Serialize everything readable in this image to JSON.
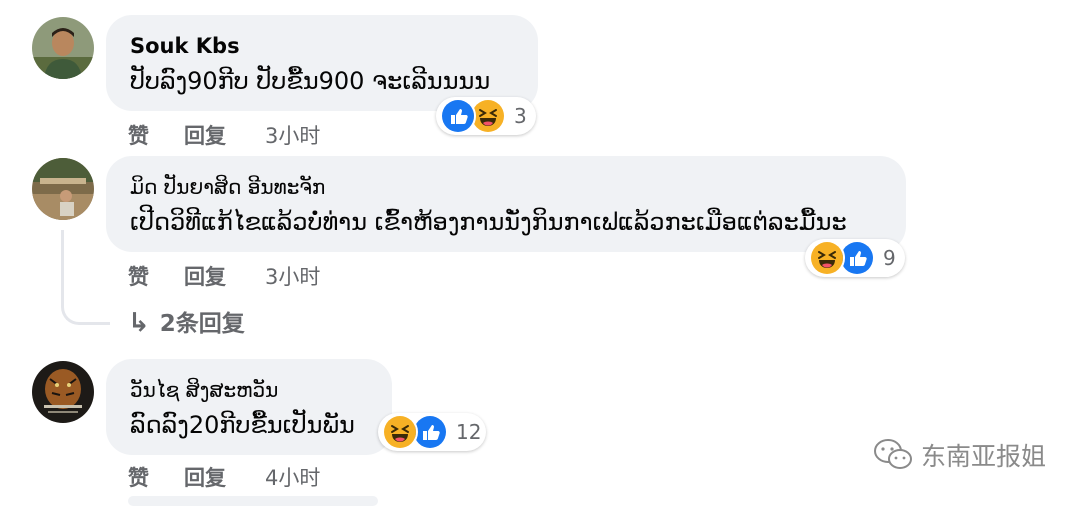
{
  "comments": [
    {
      "author": "Souk Kbs",
      "text": "ປັບລົງ90ກີບ ປັບຂື້ນ900 ຈະເລີນນນນ",
      "reactions": [
        "like-icon",
        "haha-icon"
      ],
      "reaction_count": "3",
      "actions": {
        "like": "赞",
        "reply": "回复",
        "time": "3小时"
      }
    },
    {
      "author": "ມິດ ປັນຍາສິດ ອີນທະຈັກ",
      "text": "ເປີດວິທີແກ້ໄຂແລ້ວບໍ່ທ່ານ ເຂົ້າຫ້ອງການນັ່ງກິນກາເຟແລ້ວກະເມືອແຕ່ລະມື້ນະ",
      "reactions": [
        "haha-icon",
        "like-icon"
      ],
      "reaction_count": "9",
      "actions": {
        "like": "赞",
        "reply": "回复",
        "time": "3小时"
      },
      "replies_link": "2条回复"
    },
    {
      "author": "ວັນໄຊ ສິງສະຫວັນ",
      "text": "ລົດລົງ20ກີບຂື້ນເປັນພັນ",
      "reactions": [
        "haha-icon",
        "like-icon"
      ],
      "reaction_count": "12",
      "actions": {
        "like": "赞",
        "reply": "回复",
        "time": "4小时"
      }
    }
  ],
  "watermark": "东南亚报姐",
  "colors": {
    "bubble": "#f0f2f5",
    "meta": "#65676b",
    "like_blue": "#1877f2",
    "haha_yellow": "#f7b125"
  }
}
